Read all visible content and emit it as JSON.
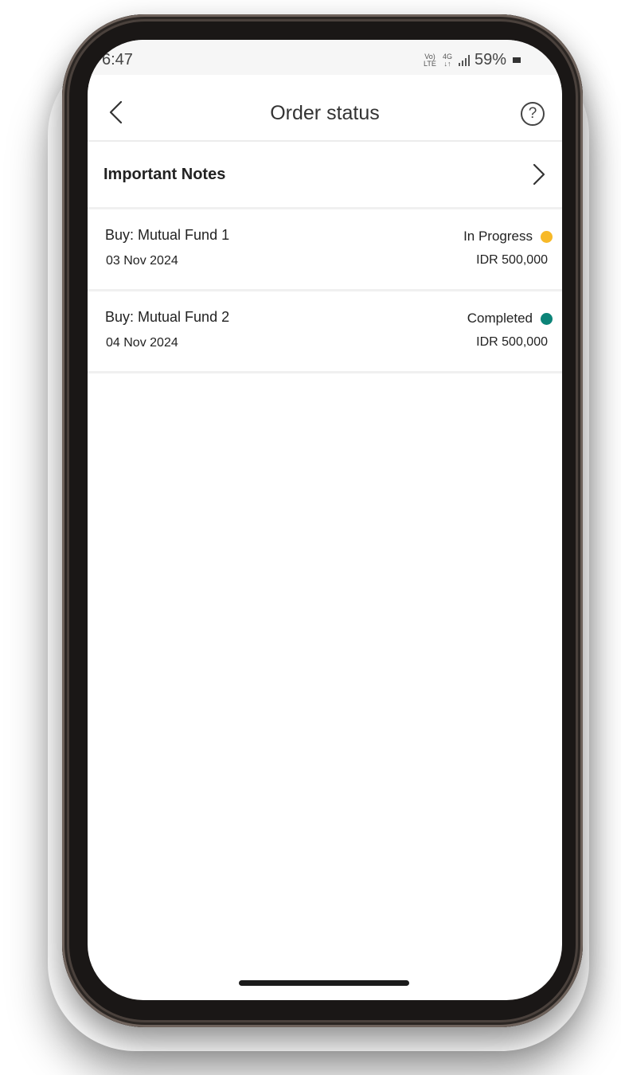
{
  "status_bar": {
    "time": "6:47",
    "network_top": "Vo)",
    "network_bottom": "LTE",
    "data_top": "4G",
    "data_bottom": "↓↑",
    "battery": "59%"
  },
  "header": {
    "title": "Order status",
    "help_symbol": "?"
  },
  "important_notes": {
    "label": "Important Notes"
  },
  "orders": [
    {
      "title": "Buy: Mutual Fund 1",
      "date": "03 Nov 2024",
      "status": "In Progress",
      "status_color": "#f7b928",
      "amount": "IDR 500,000"
    },
    {
      "title": "Buy: Mutual Fund 2",
      "date": "04 Nov 2024",
      "status": "Completed",
      "status_color": "#0c8478",
      "amount": "IDR 500,000"
    }
  ]
}
